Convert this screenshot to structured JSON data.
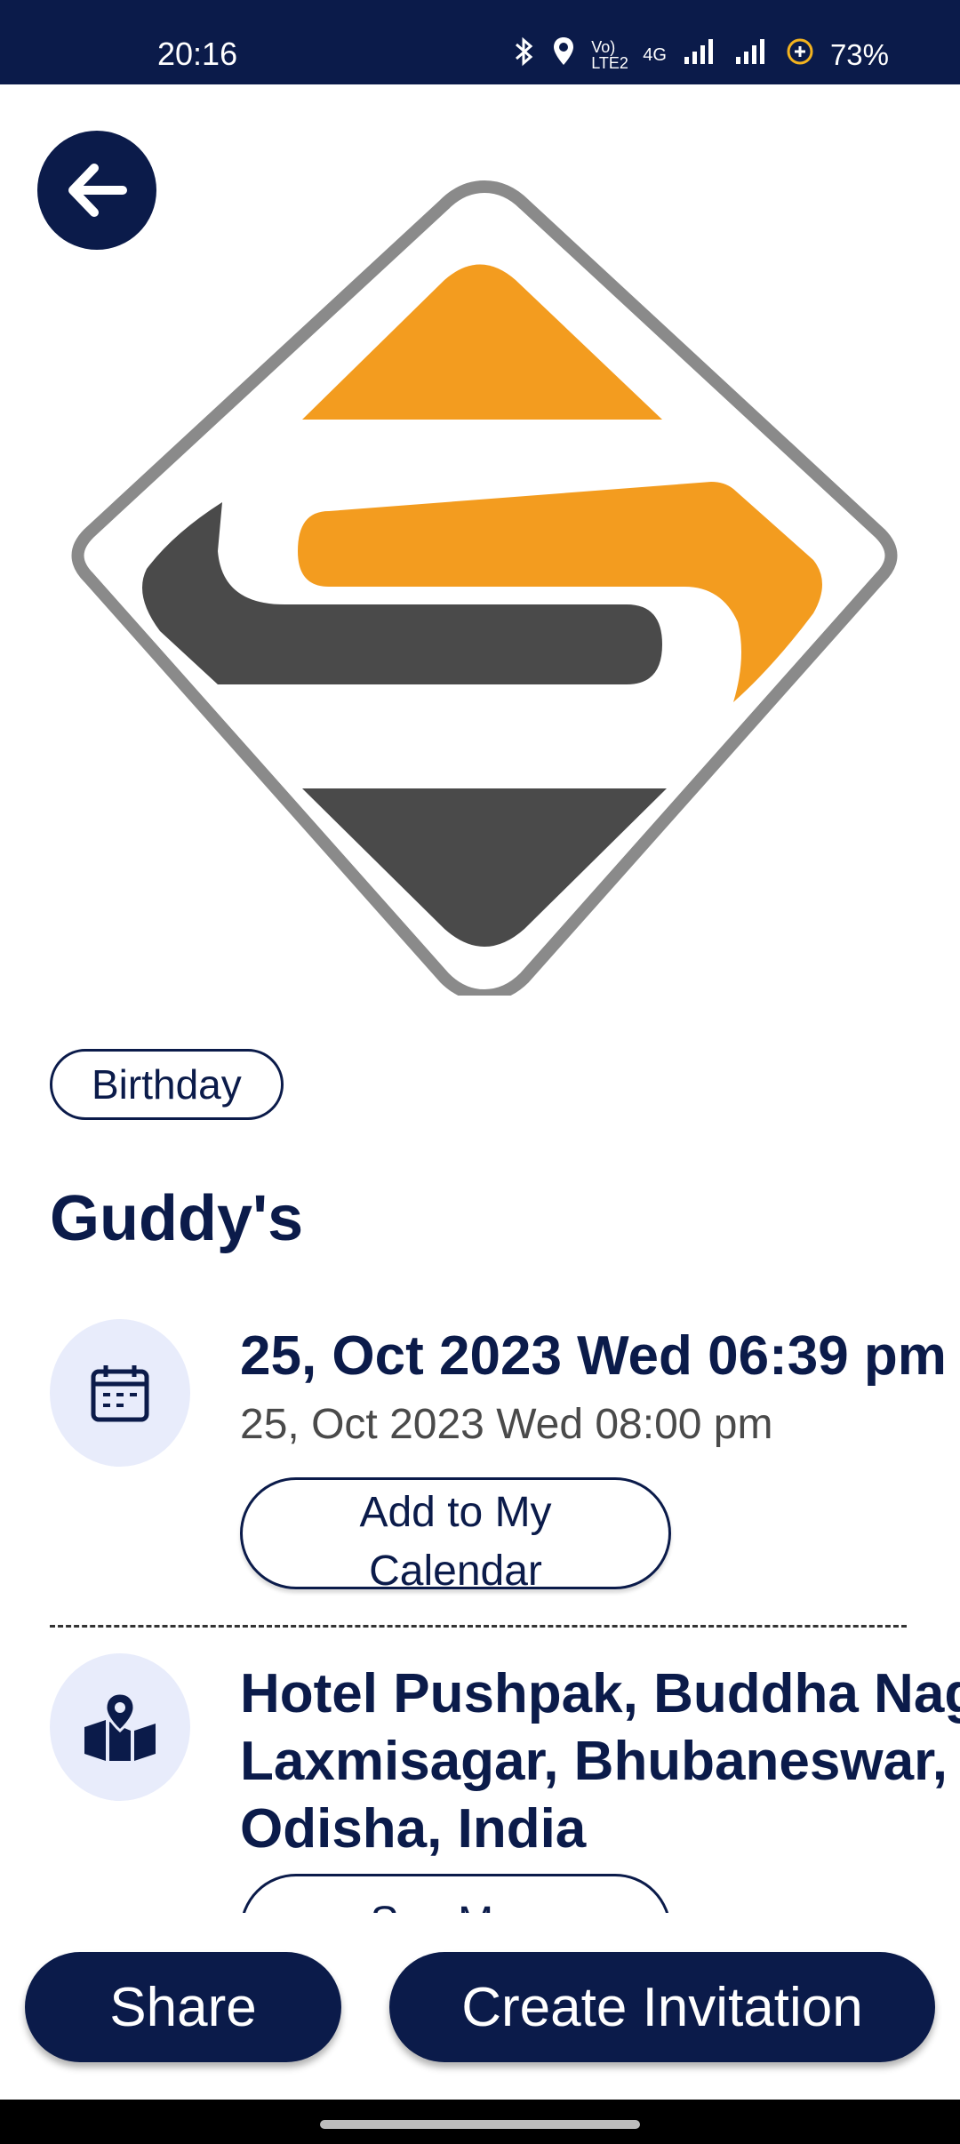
{
  "status_bar": {
    "time": "20:16",
    "bluetooth_icon": "bluetooth-icon",
    "location_icon": "location-icon",
    "volte_label": "Vo) LTE2",
    "network_label": "4G",
    "battery": "73%"
  },
  "event": {
    "category": "Birthday",
    "title": "Guddy's",
    "start": "25, Oct 2023 Wed 06:39 pm",
    "end": "25, Oct 2023 Wed 08:00 pm",
    "add_calendar_label": "Add to My\nCalendar",
    "address": "Hotel Pushpak, Buddha Nagar,\nLaxmisagar, Bhubaneswar,\nOdisha, India",
    "map_button_label": "See Map"
  },
  "actions": {
    "share": "Share",
    "create_invitation": "Create Invitation"
  },
  "colors": {
    "primary": "#0b1b4a",
    "icon_bg": "#e8ecfb",
    "logo_orange": "#f39c1f",
    "logo_gray": "#4a4a4a"
  }
}
